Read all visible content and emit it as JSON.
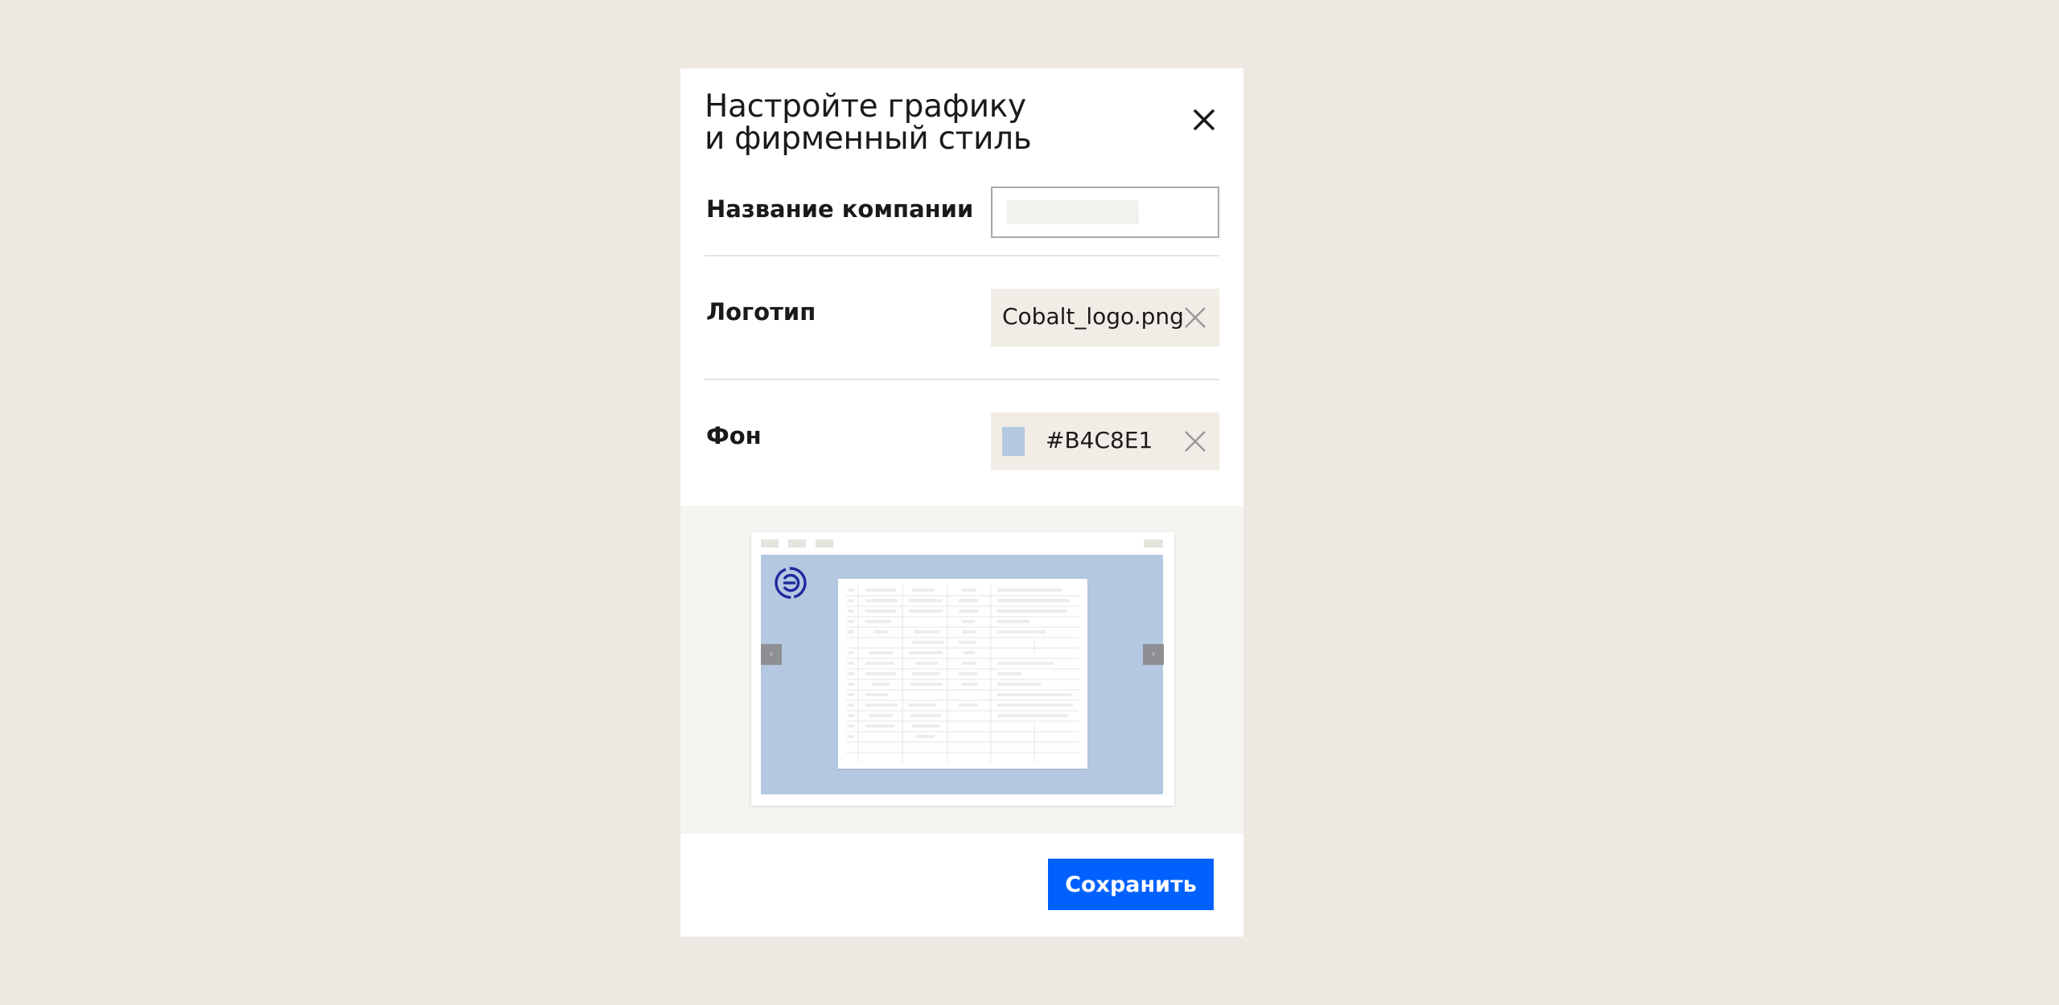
{
  "modal": {
    "title_line1": "Настройте графику",
    "title_line2": "и фирменный стиль",
    "close_icon": "close-icon"
  },
  "company": {
    "label": "Название компании",
    "value": ""
  },
  "logo": {
    "label": "Логотип",
    "file_name": "Cobalt_logo.png",
    "remove_icon": "close-icon"
  },
  "background": {
    "label": "Фон",
    "color_hex": "#B4C8E1",
    "remove_icon": "close-icon"
  },
  "preview": {
    "background_color": "#B4C8E1",
    "logo_color": "#1E2A9E",
    "prev_icon": "chevron-left-icon",
    "next_icon": "chevron-right-icon"
  },
  "footer": {
    "save_label": "Сохранить",
    "save_color": "#0061FE"
  }
}
